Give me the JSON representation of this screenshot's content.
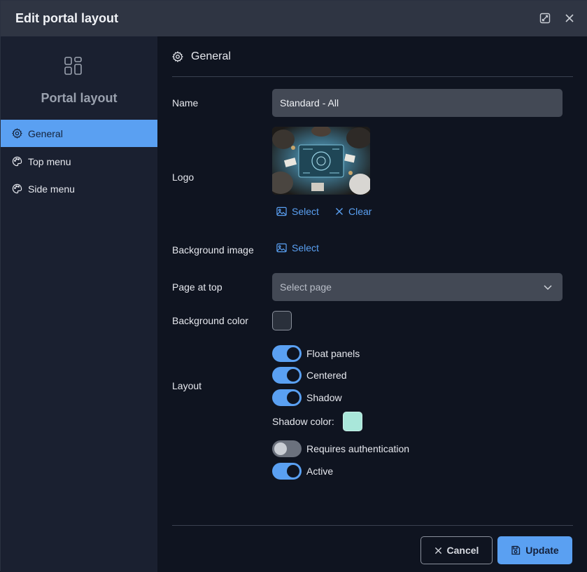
{
  "dialog": {
    "title": "Edit portal layout"
  },
  "sidebar": {
    "title": "Portal layout",
    "items": [
      {
        "label": "General",
        "icon": "gear-icon",
        "active": true
      },
      {
        "label": "Top menu",
        "icon": "palette-icon",
        "active": false
      },
      {
        "label": "Side menu",
        "icon": "palette-icon",
        "active": false
      }
    ]
  },
  "section": {
    "title": "General"
  },
  "form": {
    "name_label": "Name",
    "name_value": "Standard - All",
    "logo_label": "Logo",
    "logo_select": "Select",
    "logo_clear": "Clear",
    "bg_image_label": "Background image",
    "bg_image_select": "Select",
    "page_top_label": "Page at top",
    "page_top_placeholder": "Select page",
    "bg_color_label": "Background color",
    "bg_color_value": "#2a303b",
    "layout_label": "Layout",
    "toggles": [
      {
        "label": "Float panels",
        "on": true
      },
      {
        "label": "Centered",
        "on": true
      },
      {
        "label": "Shadow",
        "on": true
      }
    ],
    "shadow_color_label": "Shadow color:",
    "shadow_color_value": "#a9e7da",
    "toggles2": [
      {
        "label": "Requires authentication",
        "on": false
      },
      {
        "label": "Active",
        "on": true
      }
    ]
  },
  "footer": {
    "cancel_label": "Cancel",
    "update_label": "Update"
  },
  "colors": {
    "accent": "#5aa0f2",
    "titlebar": "#2f3543",
    "sidebar": "#1a2030",
    "background": "#0f1420",
    "input": "#434955"
  }
}
